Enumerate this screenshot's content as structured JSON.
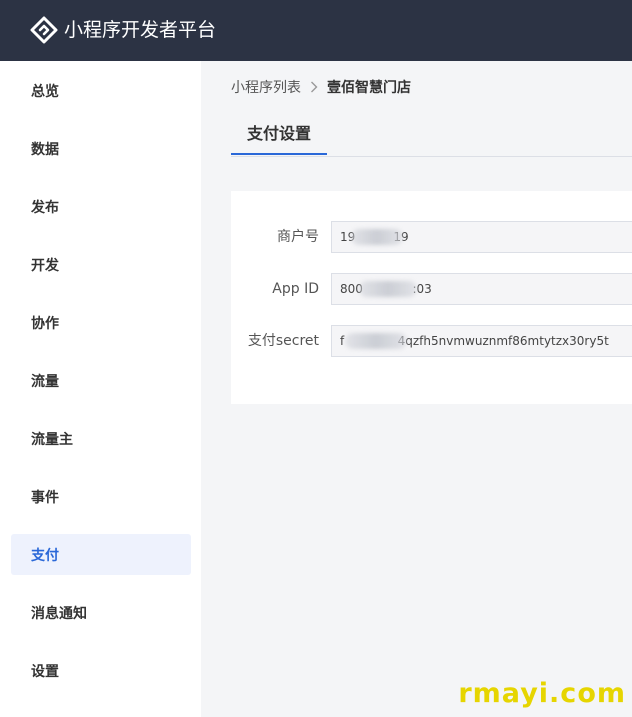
{
  "header": {
    "title": "小程序开发者平台",
    "logo_icon": "logo-icon"
  },
  "sidebar": {
    "items": [
      {
        "label": "总览",
        "active": false
      },
      {
        "label": "数据",
        "active": false
      },
      {
        "label": "发布",
        "active": false
      },
      {
        "label": "开发",
        "active": false
      },
      {
        "label": "协作",
        "active": false
      },
      {
        "label": "流量",
        "active": false
      },
      {
        "label": "流量主",
        "active": false
      },
      {
        "label": "事件",
        "active": false
      },
      {
        "label": "支付",
        "active": true
      },
      {
        "label": "消息通知",
        "active": false
      },
      {
        "label": "设置",
        "active": false
      }
    ]
  },
  "breadcrumb": {
    "parent": "小程序列表",
    "separator_icon": "chevron-right-icon",
    "current": "壹佰智慧门店"
  },
  "tabs": [
    {
      "label": "支付设置",
      "active": true
    }
  ],
  "form": {
    "merchant_id_label": "商户号",
    "merchant_id_value": "19          19",
    "app_id_label": "App ID",
    "app_id_value": "800             :03",
    "secret_label": "支付secret",
    "secret_value": "f              4qzfh5nvmwuznmf86mtytzx30ry5t"
  },
  "colors": {
    "topbar": "#2c3344",
    "accent": "#2a68d8",
    "active_bg": "#eef2fd",
    "watermark": "#e6d500"
  },
  "watermark": "rmayi.com"
}
